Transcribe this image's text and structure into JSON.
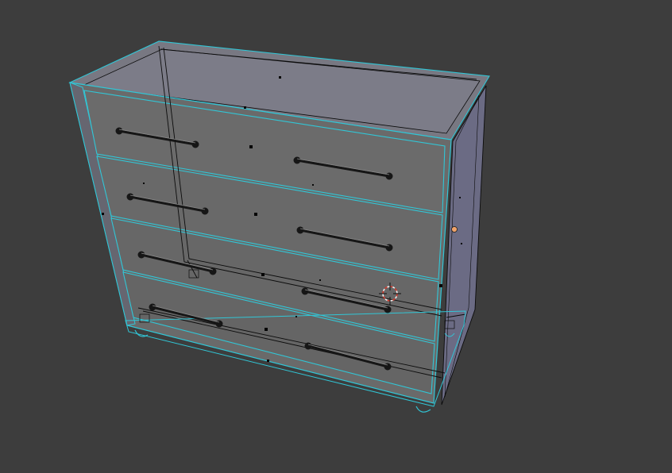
{
  "app": "3D viewport",
  "mode": "edit-mode-wireframe",
  "object": {
    "type": "chest-of-drawers",
    "drawer_count": 4,
    "handles_per_drawer": 2
  },
  "colors": {
    "viewport_bg": "#3d3d3d",
    "face_fill": "#6b6b6b",
    "face_fill_dark": "#5c5c5c",
    "side_fill": "#6c6c82",
    "top_fill": "#7a7a86",
    "selection_outline": "#31c6d6",
    "wire": "#0b0b0b",
    "handle": "#161616",
    "vertex": "#050505",
    "cursor_red": "#d33a2c",
    "cursor_white": "#f0f0f0",
    "origin_dot": "#f0a36a"
  },
  "icons": {
    "cursor": "3d-cursor-icon",
    "origin": "object-origin-icon"
  }
}
